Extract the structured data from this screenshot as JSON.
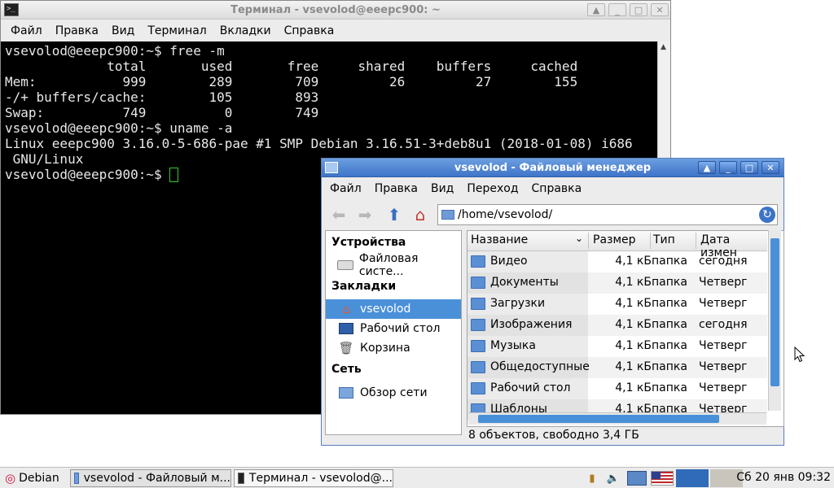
{
  "terminal": {
    "title": "Терминал - vsevolod@eeepc900: ~",
    "menu": [
      "Файл",
      "Правка",
      "Вид",
      "Терминал",
      "Вкладки",
      "Справка"
    ],
    "lines": [
      "vsevolod@eeepc900:~$ free -m",
      "             total       used       free     shared    buffers     cached",
      "Mem:           999        289        709         26         27        155",
      "-/+ buffers/cache:        105        893",
      "Swap:          749          0        749",
      "vsevolod@eeepc900:~$ uname -a",
      "Linux eeepc900 3.16.0-5-686-pae #1 SMP Debian 3.16.51-3+deb8u1 (2018-01-08) i686",
      " GNU/Linux"
    ],
    "prompt": "vsevolod@eeepc900:~$ "
  },
  "filemanager": {
    "title": "vsevolod - Файловый менеджер",
    "menu": [
      "Файл",
      "Правка",
      "Вид",
      "Переход",
      "Справка"
    ],
    "location": "/home/vsevolod/",
    "sidebar": {
      "devices_header": "Устройства",
      "devices": [
        "Файловая систе..."
      ],
      "bookmarks_header": "Закладки",
      "bookmarks": [
        "vsevolod",
        "Рабочий стол",
        "Корзина"
      ],
      "network_header": "Сеть",
      "network": [
        "Обзор сети"
      ]
    },
    "columns": [
      "Название",
      "Размер",
      "Тип",
      "Дата измен"
    ],
    "rows": [
      {
        "name": "Видео",
        "size": "4,1 кБ",
        "type": "папка",
        "date": "сегодня"
      },
      {
        "name": "Документы",
        "size": "4,1 кБ",
        "type": "папка",
        "date": "Четверг"
      },
      {
        "name": "Загрузки",
        "size": "4,1 кБ",
        "type": "папка",
        "date": "Четверг"
      },
      {
        "name": "Изображения",
        "size": "4,1 кБ",
        "type": "папка",
        "date": "сегодня"
      },
      {
        "name": "Музыка",
        "size": "4,1 кБ",
        "type": "папка",
        "date": "Четверг"
      },
      {
        "name": "Общедоступные",
        "size": "4,1 кБ",
        "type": "папка",
        "date": "Четверг"
      },
      {
        "name": "Рабочий стол",
        "size": "4,1 кБ",
        "type": "папка",
        "date": "Четверг"
      },
      {
        "name": "Шаблоны",
        "size": "4,1 кБ",
        "type": "папка",
        "date": "Четверг"
      }
    ],
    "status": "8 объектов, свободно 3,4 ГБ"
  },
  "taskbar": {
    "start_label": "Debian",
    "tasks": [
      "vsevolod - Файловый м...",
      "Терминал - vsevolod@..."
    ],
    "clock": "Сб 20 янв 09:32"
  },
  "colors": {
    "selection": "#4a90d9",
    "terminal_bg": "#000000",
    "cursor": "#33cc33",
    "fm_title": "#3f74c8"
  }
}
